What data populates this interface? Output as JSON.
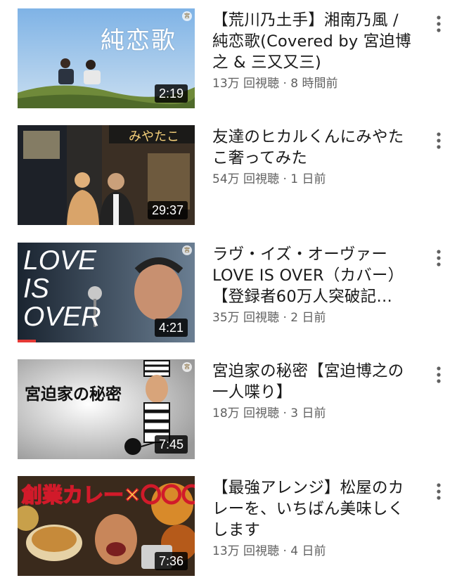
{
  "videos": [
    {
      "title": "【荒川乃土手】湘南乃風 / 純恋歌(Covered by 宮迫博之 & 三又又三)",
      "views": "13万 回視聴",
      "age": "8 時間前",
      "duration": "2:19",
      "thumb_text": "純恋歌",
      "badge": "宮"
    },
    {
      "title": "友達のヒカルくんにみやたこ奢ってみた",
      "views": "54万 回視聴",
      "age": "1 日前",
      "duration": "29:37",
      "thumb_text": "みやたこ",
      "badge": ""
    },
    {
      "title": "ラヴ・イズ・オーヴァー LOVE IS OVER（カバー）【登録者60万人突破記…",
      "views": "35万 回視聴",
      "age": "2 日前",
      "duration": "4:21",
      "thumb_text": "LOVE IS OVER",
      "badge": "宮"
    },
    {
      "title": "宮迫家の秘密【宮迫博之の一人喋り】",
      "views": "18万 回視聴",
      "age": "3 日前",
      "duration": "7:45",
      "thumb_text": "宮迫家の秘密",
      "badge": "宮"
    },
    {
      "title": "【最強アレンジ】松屋のカレーを、いちばん美味しくします",
      "views": "13万 回視聴",
      "age": "4 日前",
      "duration": "7:36",
      "thumb_text": "創業カレー✕〇〇〇",
      "badge": ""
    }
  ],
  "separator": " · ",
  "icons": {
    "more": "vertical-ellipsis-icon"
  },
  "colors": {
    "stats": "#606060",
    "duration_bg": "#000000",
    "title": "#1a1a1a"
  }
}
